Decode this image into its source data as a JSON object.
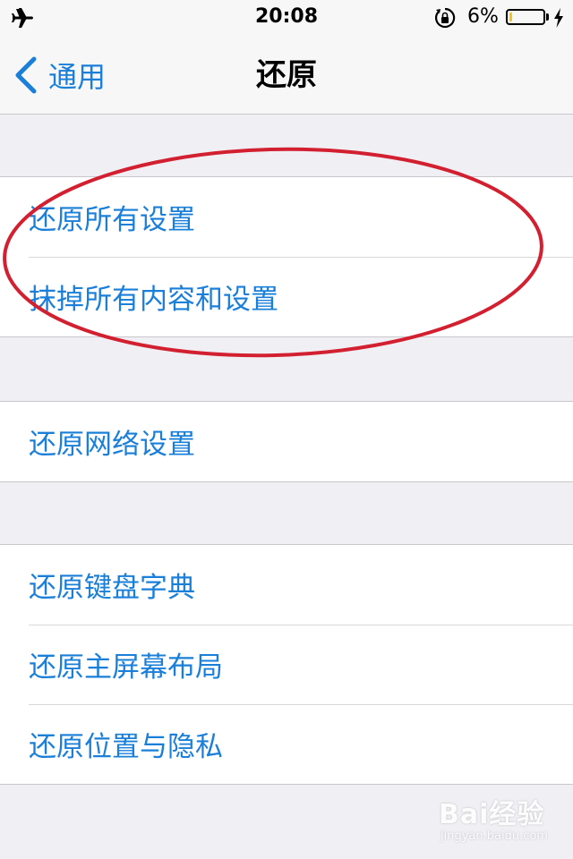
{
  "status_bar": {
    "time": "20:08",
    "battery_percent": "6%",
    "battery_level": 0.06,
    "icons": [
      "airplane-icon",
      "rotation-lock-icon",
      "battery-icon",
      "charging-bolt-icon"
    ]
  },
  "nav": {
    "back_label": "通用",
    "title": "还原"
  },
  "groups": [
    {
      "items": [
        "还原所有设置",
        "抹掉所有内容和设置"
      ]
    },
    {
      "items": [
        "还原网络设置"
      ]
    },
    {
      "items": [
        "还原键盘字典",
        "还原主屏幕布局",
        "还原位置与隐私"
      ]
    }
  ],
  "colors": {
    "accent": "#1a7fd9",
    "annotation": "#d32030",
    "background": "#efeff4"
  },
  "watermark": {
    "main": "Bai经验",
    "sub": "jingyan.baidu.com"
  }
}
